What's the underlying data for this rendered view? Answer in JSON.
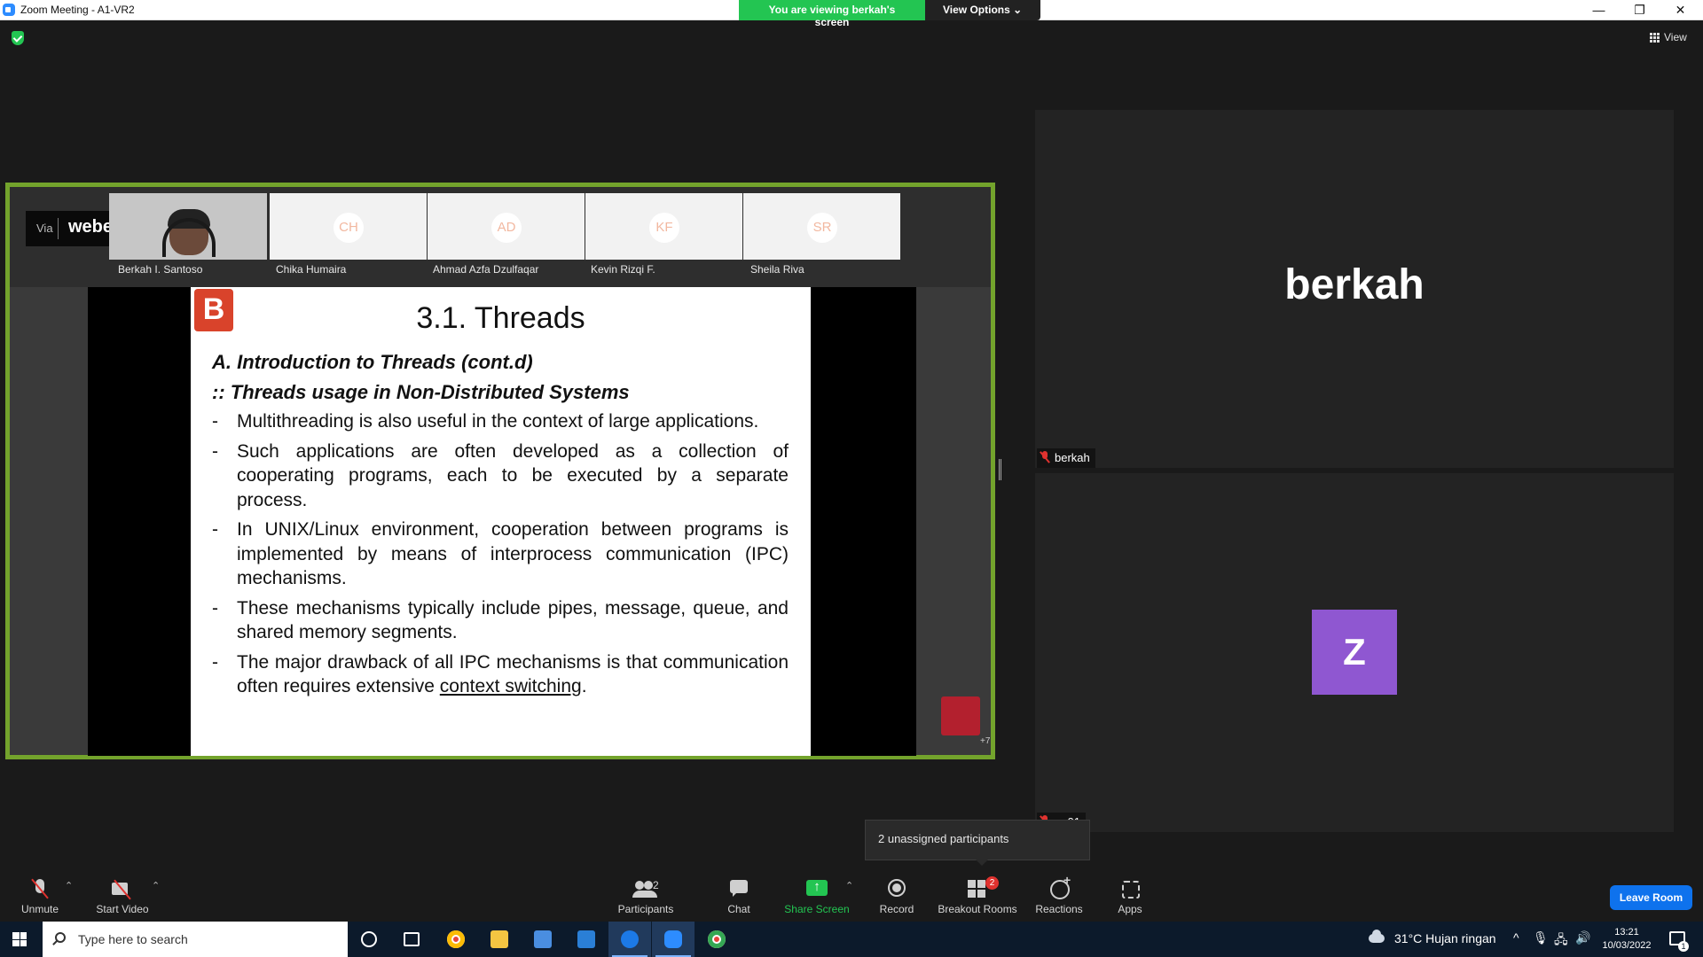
{
  "window": {
    "title": "Zoom Meeting - A1-VR2",
    "viewing_banner": "You are viewing berkah's screen",
    "view_options": "View Options ⌄",
    "view_label": "View"
  },
  "shared_screen": {
    "webex": {
      "via": "Via",
      "brand": "webex"
    },
    "participants": [
      {
        "name": "Berkah I. Santoso",
        "initials": ""
      },
      {
        "name": "Chika Humaira",
        "initials": "CH"
      },
      {
        "name": "Ahmad Azfa Dzulfaqar",
        "initials": "AD"
      },
      {
        "name": "Kevin Rizqi F.",
        "initials": "KF"
      },
      {
        "name": "Sheila Riva",
        "initials": "SR"
      }
    ],
    "extra_count": "+7",
    "slide": {
      "logo": "B",
      "title": "3.1. Threads",
      "subtitle1": "A.   Introduction to Threads  (cont.d)",
      "subtitle2": ":: Threads usage in Non-Distributed Systems",
      "bullets": [
        "Multithreading is also useful in the context of large applications.",
        "Such applications are often developed as a collection of cooperating programs, each to be executed by a separate process.",
        "In UNIX/Linux environment, cooperation between programs is implemented by means of interprocess communication (IPC) mechanisms.",
        "These mechanisms typically include pipes, message, queue, and shared memory segments.",
        "The major drawback of all IPC mechanisms is that communication often requires extensive "
      ],
      "last_bullet_underlined": "context switching",
      "last_bullet_end": ".",
      "bullet_dash": "-"
    }
  },
  "right_panel": {
    "tile1": {
      "big_name": "berkah",
      "label": "berkah"
    },
    "tile2": {
      "avatar_letter": "Z",
      "label": "aa01"
    }
  },
  "tooltip": {
    "text": "2 unassigned participants"
  },
  "toolbar": {
    "unmute": "Unmute",
    "start_video": "Start Video",
    "participants": "Participants",
    "participants_count": "2",
    "chat": "Chat",
    "share_screen": "Share Screen",
    "record": "Record",
    "breakout_rooms": "Breakout Rooms",
    "breakout_badge": "2",
    "reactions": "Reactions",
    "apps": "Apps",
    "leave_room": "Leave Room",
    "caret": "⌃"
  },
  "taskbar": {
    "search_placeholder": "Type here to search",
    "weather": "31°C  Hujan ringan",
    "time": "13:21",
    "date": "10/03/2022",
    "notification_count": "1"
  },
  "colors": {
    "share_border": "#73a32c",
    "zoom_green": "#23c552",
    "leave_blue": "#0e72ed",
    "avatar_purple": "#8f57d1",
    "taskbar": "#0c1a2b"
  }
}
